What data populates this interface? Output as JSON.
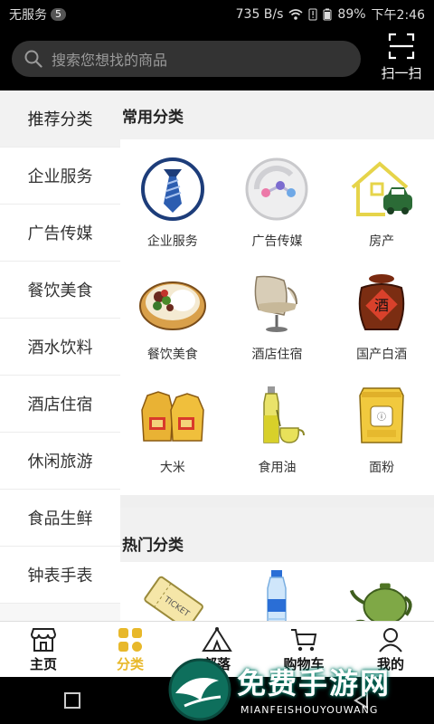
{
  "status_bar": {
    "carrier": "无服务",
    "notif_count": "5",
    "speed": "735 B/s",
    "battery": "89%",
    "time": "下午2:46"
  },
  "header": {
    "search_placeholder": "搜索您想找的商品",
    "scan_label": "扫一扫"
  },
  "sidebar": {
    "items": [
      {
        "label": "推荐分类",
        "active": true
      },
      {
        "label": "企业服务"
      },
      {
        "label": "广告传媒"
      },
      {
        "label": "餐饮美食"
      },
      {
        "label": "酒水饮料"
      },
      {
        "label": "酒店住宿"
      },
      {
        "label": "休闲旅游"
      },
      {
        "label": "食品生鲜"
      },
      {
        "label": "钟表手表"
      }
    ]
  },
  "main": {
    "common_title": "常用分类",
    "common": [
      {
        "label": "企业服务",
        "icon": "tie-icon"
      },
      {
        "label": "广告传媒",
        "icon": "share-icon"
      },
      {
        "label": "房产",
        "icon": "house-car-icon"
      },
      {
        "label": "餐饮美食",
        "icon": "food-bowl-icon"
      },
      {
        "label": "酒店住宿",
        "icon": "chair-icon"
      },
      {
        "label": "国产白酒",
        "icon": "liquor-jar-icon"
      },
      {
        "label": "大米",
        "icon": "rice-bag-icon"
      },
      {
        "label": "食用油",
        "icon": "oil-bottle-icon"
      },
      {
        "label": "面粉",
        "icon": "flour-bag-icon"
      }
    ],
    "hot_title": "热门分类",
    "hot": [
      {
        "icon": "ticket-icon",
        "text": "TICKET"
      },
      {
        "icon": "water-bottle-icon"
      },
      {
        "icon": "teapot-icon"
      }
    ]
  },
  "tabbar": {
    "tabs": [
      {
        "label": "主页",
        "icon": "shop-icon"
      },
      {
        "label": "分类",
        "icon": "category-icon",
        "active": true
      },
      {
        "label": "部落",
        "icon": "tent-icon"
      },
      {
        "label": "购物车",
        "icon": "cart-icon"
      },
      {
        "label": "我的",
        "icon": "user-icon"
      }
    ]
  },
  "watermark": {
    "title": "免费手游网",
    "subtitle": "MIANFEISHOUYOUWANG"
  },
  "colors": {
    "accent": "#e8b82a",
    "header_bg": "#000000"
  }
}
